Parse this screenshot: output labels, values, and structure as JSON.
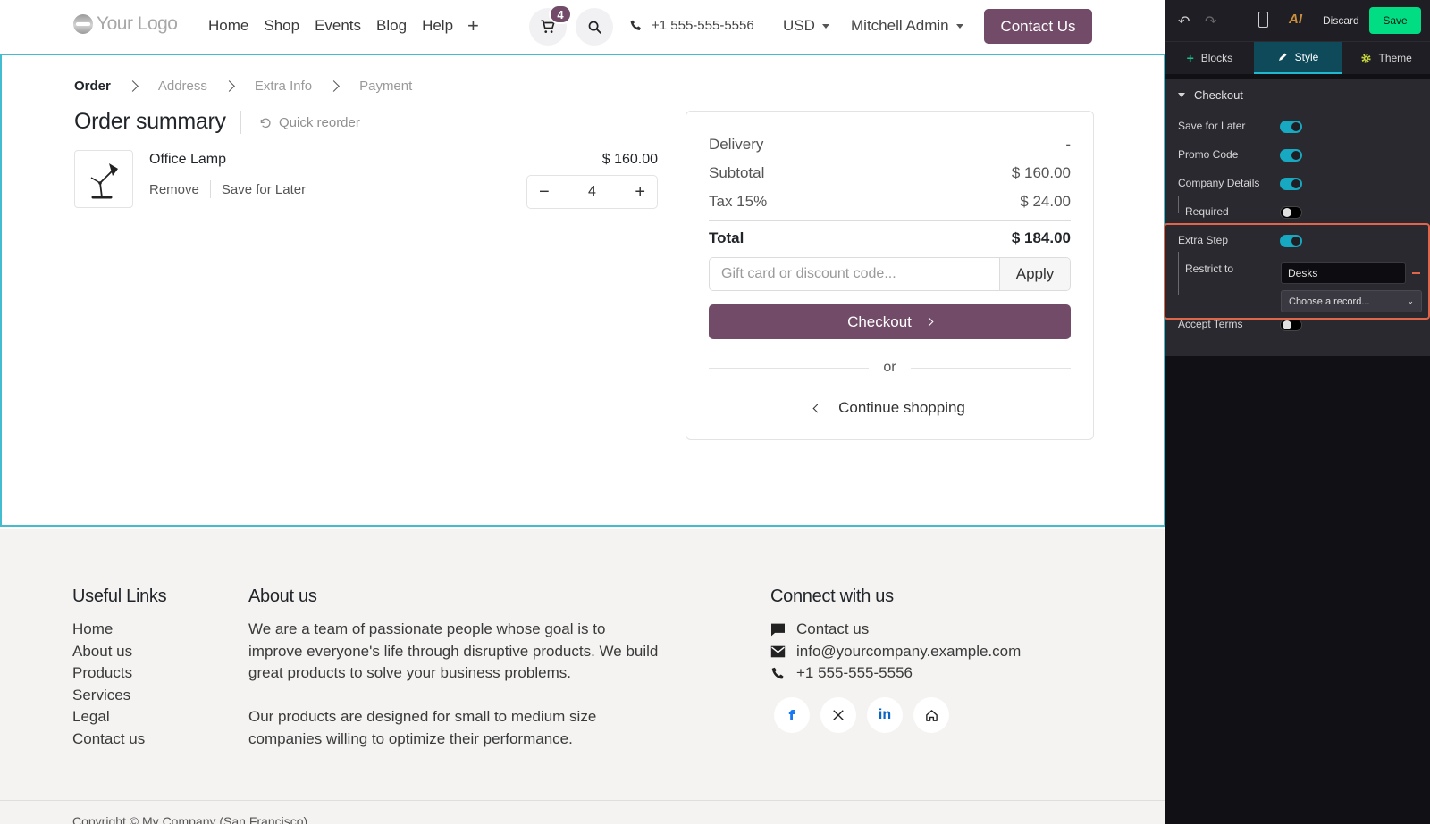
{
  "navbar": {
    "logo_text": "Your Logo",
    "links": [
      "Home",
      "Shop",
      "Events",
      "Blog",
      "Help"
    ],
    "cart_count": "4",
    "phone": "+1 555-555-5556",
    "currency": "USD",
    "user": "Mitchell Admin",
    "contact_button": "Contact Us"
  },
  "steps": [
    {
      "label": "Order",
      "active": true
    },
    {
      "label": "Address",
      "active": false
    },
    {
      "label": "Extra Info",
      "active": false
    },
    {
      "label": "Payment",
      "active": false
    }
  ],
  "order": {
    "title": "Order summary",
    "quick_reorder": "Quick reorder",
    "product": {
      "name": "Office Lamp",
      "price": "$ 160.00",
      "quantity": "4",
      "remove_label": "Remove",
      "save_later_label": "Save for Later"
    }
  },
  "summary": {
    "delivery_label": "Delivery",
    "delivery_value": "-",
    "subtotal_label": "Subtotal",
    "subtotal_value": "$ 160.00",
    "tax_label": "Tax 15%",
    "tax_value": "$ 24.00",
    "total_label": "Total",
    "total_value": "$ 184.00",
    "promo_placeholder": "Gift card or discount code...",
    "apply_label": "Apply",
    "checkout_label": "Checkout",
    "or_label": "or",
    "continue_label": "Continue shopping"
  },
  "footer": {
    "useful_links_title": "Useful Links",
    "useful_links": [
      "Home",
      "About us",
      "Products",
      "Services",
      "Legal",
      "Contact us"
    ],
    "about_title": "About us",
    "about_p1": "We are a team of passionate people whose goal is to improve everyone's life through disruptive products. We build great products to solve your business problems.",
    "about_p2": "Our products are designed for small to medium size companies willing to optimize their performance.",
    "connect_title": "Connect with us",
    "contact_link": "Contact us",
    "email": "info@yourcompany.example.com",
    "phone": "+1 555-555-5556",
    "social": [
      "facebook",
      "x",
      "linkedin",
      "home"
    ],
    "copyright": "Copyright © My Company (San Francisco)"
  },
  "editor": {
    "discard_label": "Discard",
    "save_label": "Save",
    "tabs": [
      {
        "label": "Blocks",
        "active": false
      },
      {
        "label": "Style",
        "active": true
      },
      {
        "label": "Theme",
        "active": false
      }
    ],
    "section_title": "Checkout",
    "options": {
      "save_for_later": {
        "label": "Save for Later",
        "on": true
      },
      "promo_code": {
        "label": "Promo Code",
        "on": true
      },
      "company_details": {
        "label": "Company Details",
        "on": true
      },
      "required": {
        "label": "Required",
        "on": false
      },
      "extra_step": {
        "label": "Extra Step",
        "on": true
      },
      "restrict_to_label": "Restrict to",
      "restrict_to_value": "Desks",
      "choose_record_label": "Choose a record...",
      "accept_terms": {
        "label": "Accept Terms",
        "on": false
      }
    }
  },
  "colors": {
    "brand": "#714b67",
    "editor_accent": "#16a9c1",
    "save_green": "#00dd83",
    "highlight": "#e0664b",
    "section_outline": "#42bdd0"
  }
}
